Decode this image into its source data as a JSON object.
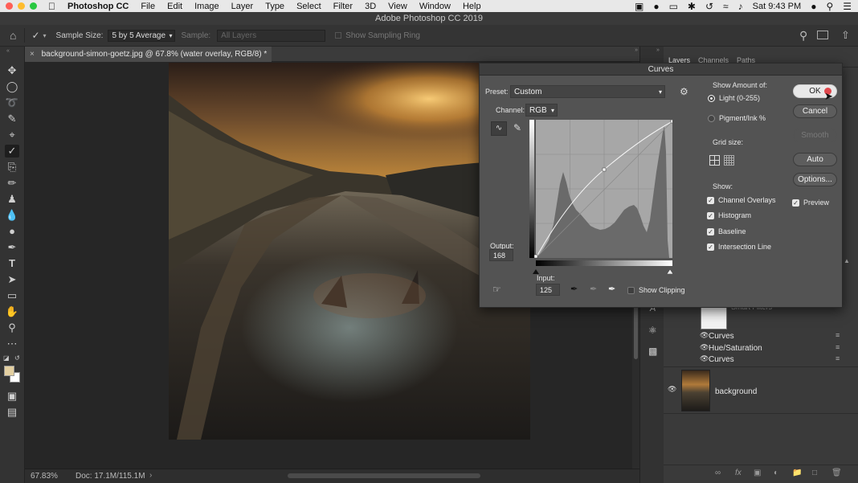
{
  "menubar": {
    "app": "Photoshop CC",
    "items": [
      "File",
      "Edit",
      "Image",
      "Layer",
      "Type",
      "Select",
      "Filter",
      "3D",
      "View",
      "Window",
      "Help"
    ],
    "clock": "Sat 9:43 PM"
  },
  "window_title": "Adobe Photoshop CC 2019",
  "options": {
    "sample_size_label": "Sample Size:",
    "sample_size_value": "5 by 5 Average",
    "sample_label": "Sample:",
    "sample_value": "All Layers",
    "show_ring": "Show Sampling Ring"
  },
  "document_tab": "background-simon-goetz.jpg @ 67.8% (water overlay, RGB/8) *",
  "status": {
    "zoom": "67.83%",
    "doc": "Doc: 17.1M/115.1M"
  },
  "panel_tabs": [
    "Layers",
    "Channels",
    "Paths"
  ],
  "layers": [
    {
      "name": "Curves",
      "kind": "adjustment"
    },
    {
      "name": "Hue/Saturation",
      "kind": "adjustment"
    },
    {
      "name": "Curves",
      "kind": "adjustment"
    },
    {
      "name": "background",
      "kind": "image"
    }
  ],
  "partial_layer_label": "Smart Filters",
  "curves": {
    "title": "Curves",
    "preset_label": "Preset:",
    "preset_value": "Custom",
    "channel_label": "Channel:",
    "channel_value": "RGB",
    "output_label": "Output:",
    "output_value": "168",
    "input_label": "Input:",
    "input_value": "125",
    "show_clipping": "Show Clipping",
    "show_amount_label": "Show Amount of:",
    "light": "Light  (0-255)",
    "pigment": "Pigment/Ink %",
    "grid_size_label": "Grid size:",
    "show_label": "Show:",
    "checks": [
      "Channel Overlays",
      "Histogram",
      "Baseline",
      "Intersection Line"
    ],
    "preview": "Preview",
    "buttons": {
      "ok": "OK",
      "cancel": "Cancel",
      "smooth": "Smooth",
      "auto": "Auto",
      "options": "Options..."
    }
  },
  "colors": {
    "accent_close": "#ff5f57",
    "accent_min": "#febc2e",
    "accent_max": "#28c840",
    "ok_indicator": "#e0474c"
  }
}
